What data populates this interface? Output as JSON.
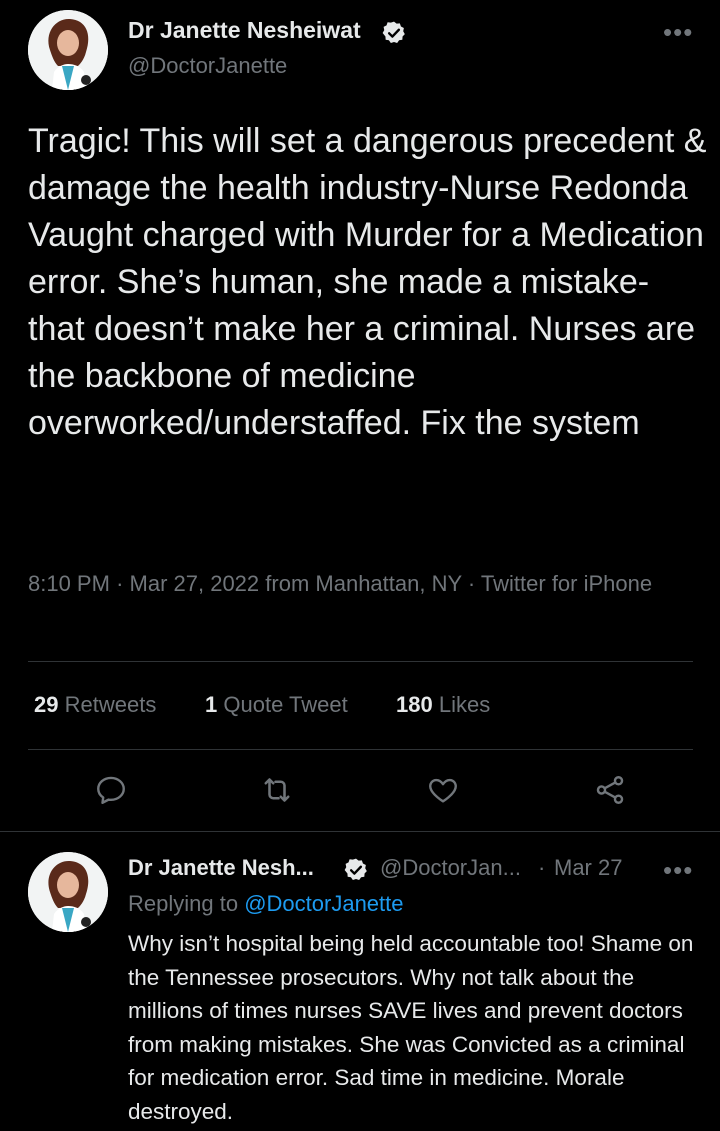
{
  "main_tweet": {
    "author_name": "Dr Janette Nesheiwat",
    "author_handle": "@DoctorJanette",
    "text": "Tragic! This will set a dangerous precedent & damage the health industry-Nurse Redonda Vaught charged with Murder for a Medication error. She’s human, she made a mistake- that doesn’t make her a criminal. Nurses are the backbone of medicine overworked/understaffed. Fix the system",
    "time": "8:10 PM",
    "sep1": "·",
    "date": "Mar 27, 2022",
    "location": "from Manhattan, NY",
    "sep2": "·",
    "source": "Twitter for iPhone",
    "more_icon": "•••"
  },
  "stats": {
    "retweets_count": "29",
    "retweets_label": "Retweets",
    "quotes_count": "1",
    "quotes_label": "Quote Tweet",
    "likes_count": "180",
    "likes_label": "Likes"
  },
  "actions": [
    "reply-icon",
    "retweet-icon",
    "like-icon",
    "share-icon"
  ],
  "reply_tweet": {
    "author_name": "Dr Janette Nesh...",
    "author_handle": "@DoctorJan...",
    "sep": "·",
    "date": "Mar 27",
    "replying_prefix": "Replying to",
    "replying_to": "@DoctorJanette",
    "text": "Why isn’t hospital being held accountable too! Shame on the Tennessee prosecutors. Why not talk about the millions of times nurses SAVE lives and prevent doctors from making mistakes. She was Convicted as a criminal for medication error. Sad time in medicine. Morale destroyed.",
    "more_icon": "•••"
  },
  "colors": {
    "background": "#000000",
    "text": "#e7e9ea",
    "secondary": "#71767b",
    "link": "#1d9bf0",
    "divider": "#2f3336"
  }
}
